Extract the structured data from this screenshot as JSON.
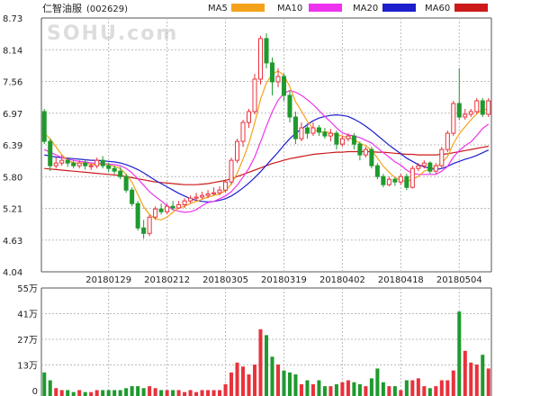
{
  "header": {
    "stock_name": "仁智油服",
    "stock_code": "(002629)",
    "watermark": "SOHU.com"
  },
  "colors": {
    "up": "#e8323c",
    "down": "#1f9a2e",
    "ma5": "#f5a21b",
    "ma10": "#ee33ee",
    "ma20": "#1e1ecc",
    "ma60": "#cc1a1a",
    "grid": "#bbbbbb",
    "frame": "#555555"
  },
  "chart_data": [
    {
      "type": "candlestick",
      "legend": [
        {
          "name": "MA5",
          "color": "#f5a21b"
        },
        {
          "name": "MA10",
          "color": "#ee33ee"
        },
        {
          "name": "MA20",
          "color": "#1e1ecc"
        },
        {
          "name": "MA60",
          "color": "#cc1a1a"
        }
      ],
      "y_ticks": [
        "8.73",
        "8.14",
        "7.56",
        "6.97",
        "6.39",
        "5.80",
        "5.21",
        "4.63",
        "4.04"
      ],
      "ylim": [
        4.04,
        8.73
      ],
      "x_ticks": [
        {
          "label": "20180129",
          "index": 11
        },
        {
          "label": "20180212",
          "index": 21
        },
        {
          "label": "20180305",
          "index": 31
        },
        {
          "label": "20180319",
          "index": 41
        },
        {
          "label": "20180402",
          "index": 51
        },
        {
          "label": "20180418",
          "index": 61
        },
        {
          "label": "20180504",
          "index": 71
        }
      ],
      "candles": [
        [
          7.0,
          6.45,
          7.05,
          6.4
        ],
        [
          6.45,
          6.0,
          6.5,
          5.9
        ],
        [
          6.0,
          6.05,
          6.15,
          5.95
        ],
        [
          6.05,
          6.1,
          6.2,
          6.0
        ],
        [
          6.1,
          6.05,
          6.15,
          5.98
        ],
        [
          6.05,
          6.0,
          6.1,
          5.95
        ],
        [
          6.0,
          6.05,
          6.1,
          5.95
        ],
        [
          6.05,
          6.0,
          6.12,
          5.93
        ],
        [
          6.0,
          6.0,
          6.05,
          5.92
        ],
        [
          6.0,
          6.1,
          6.15,
          5.95
        ],
        [
          6.1,
          6.0,
          6.18,
          5.95
        ],
        [
          6.0,
          5.95,
          6.05,
          5.88
        ],
        [
          5.95,
          5.9,
          6.0,
          5.85
        ],
        [
          5.9,
          5.8,
          5.98,
          5.75
        ],
        [
          5.8,
          5.55,
          5.85,
          5.5
        ],
        [
          5.55,
          5.3,
          5.6,
          5.25
        ],
        [
          5.3,
          4.85,
          5.35,
          4.8
        ],
        [
          4.85,
          4.75,
          5.0,
          4.65
        ],
        [
          4.75,
          5.05,
          5.1,
          4.7
        ],
        [
          5.05,
          5.2,
          5.25,
          5.0
        ],
        [
          5.2,
          5.15,
          5.3,
          5.1
        ],
        [
          5.15,
          5.25,
          5.3,
          5.1
        ],
        [
          5.25,
          5.22,
          5.35,
          5.18
        ],
        [
          5.22,
          5.28,
          5.35,
          5.2
        ],
        [
          5.28,
          5.35,
          5.4,
          5.22
        ],
        [
          5.35,
          5.4,
          5.45,
          5.3
        ],
        [
          5.4,
          5.42,
          5.5,
          5.35
        ],
        [
          5.42,
          5.45,
          5.52,
          5.38
        ],
        [
          5.45,
          5.48,
          5.55,
          5.4
        ],
        [
          5.48,
          5.5,
          5.6,
          5.45
        ],
        [
          5.5,
          5.55,
          5.62,
          5.45
        ],
        [
          5.55,
          5.7,
          5.75,
          5.5
        ],
        [
          5.7,
          6.1,
          6.15,
          5.65
        ],
        [
          6.1,
          6.45,
          6.5,
          6.05
        ],
        [
          6.45,
          6.8,
          6.85,
          6.35
        ],
        [
          6.8,
          7.0,
          7.05,
          6.7
        ],
        [
          7.0,
          7.6,
          7.7,
          6.95
        ],
        [
          7.6,
          8.35,
          8.4,
          7.5
        ],
        [
          8.35,
          7.9,
          8.45,
          7.8
        ],
        [
          7.9,
          7.55,
          8.0,
          7.3
        ],
        [
          7.55,
          7.65,
          7.8,
          7.45
        ],
        [
          7.65,
          7.3,
          7.7,
          7.2
        ],
        [
          7.3,
          6.9,
          7.4,
          6.8
        ],
        [
          6.9,
          6.5,
          7.0,
          6.4
        ],
        [
          6.5,
          6.7,
          6.8,
          6.45
        ],
        [
          6.7,
          6.6,
          6.78,
          6.5
        ],
        [
          6.6,
          6.7,
          6.8,
          6.55
        ],
        [
          6.7,
          6.62,
          6.75,
          6.55
        ],
        [
          6.62,
          6.55,
          6.7,
          6.5
        ],
        [
          6.55,
          6.6,
          6.68,
          6.45
        ],
        [
          6.6,
          6.4,
          6.65,
          6.3
        ],
        [
          6.4,
          6.5,
          6.55,
          6.35
        ],
        [
          6.5,
          6.55,
          6.6,
          6.45
        ],
        [
          6.55,
          6.4,
          6.6,
          6.3
        ],
        [
          6.4,
          6.2,
          6.45,
          6.1
        ],
        [
          6.2,
          6.3,
          6.35,
          6.15
        ],
        [
          6.3,
          6.0,
          6.35,
          5.95
        ],
        [
          6.0,
          5.8,
          6.05,
          5.75
        ],
        [
          5.8,
          5.65,
          5.85,
          5.6
        ],
        [
          5.65,
          5.75,
          5.8,
          5.62
        ],
        [
          5.75,
          5.7,
          5.78,
          5.63
        ],
        [
          5.7,
          5.8,
          5.85,
          5.65
        ],
        [
          5.8,
          5.6,
          5.85,
          5.55
        ],
        [
          5.6,
          5.95,
          6.0,
          5.58
        ],
        [
          5.95,
          6.0,
          6.05,
          5.9
        ],
        [
          6.0,
          6.05,
          6.1,
          5.95
        ],
        [
          6.05,
          5.9,
          6.08,
          5.85
        ],
        [
          5.9,
          6.0,
          6.05,
          5.85
        ],
        [
          6.0,
          6.3,
          6.35,
          5.95
        ],
        [
          6.3,
          6.6,
          6.65,
          6.25
        ],
        [
          6.6,
          7.15,
          7.2,
          6.55
        ],
        [
          7.15,
          6.9,
          7.8,
          6.85
        ],
        [
          6.9,
          6.95,
          7.05,
          6.85
        ],
        [
          6.95,
          7.0,
          7.05,
          6.9
        ],
        [
          7.0,
          7.2,
          7.25,
          6.95
        ],
        [
          7.2,
          6.95,
          7.25,
          6.9
        ],
        [
          6.95,
          7.2,
          7.25,
          6.9
        ]
      ],
      "ma5": [
        6.6,
        6.5,
        6.35,
        6.2,
        6.1,
        6.05,
        6.05,
        6.05,
        6.02,
        6.03,
        6.03,
        6.01,
        5.99,
        5.95,
        5.84,
        5.7,
        5.47,
        5.24,
        5.1,
        5.02,
        5.0,
        5.05,
        5.14,
        5.22,
        5.25,
        5.3,
        5.34,
        5.38,
        5.42,
        5.45,
        5.48,
        5.54,
        5.66,
        5.86,
        6.12,
        6.41,
        6.79,
        7.23,
        7.53,
        7.69,
        7.75,
        7.67,
        7.46,
        7.18,
        7.01,
        6.82,
        6.68,
        6.62,
        6.63,
        6.61,
        6.57,
        6.55,
        6.52,
        6.49,
        6.41,
        6.37,
        6.29,
        6.14,
        5.99,
        5.88,
        5.78,
        5.74,
        5.7,
        5.76,
        5.8,
        5.9,
        5.94,
        5.98,
        6.05,
        6.17,
        6.41,
        6.59,
        6.72,
        6.85,
        6.96,
        7.04,
        7.04
      ],
      "ma10": [
        6.3,
        6.25,
        6.2,
        6.15,
        6.12,
        6.1,
        6.08,
        6.07,
        6.05,
        6.05,
        6.04,
        6.03,
        6.02,
        6.0,
        5.95,
        5.87,
        5.76,
        5.64,
        5.52,
        5.43,
        5.35,
        5.26,
        5.19,
        5.16,
        5.14,
        5.15,
        5.19,
        5.26,
        5.32,
        5.34,
        5.39,
        5.44,
        5.52,
        5.64,
        5.79,
        5.95,
        6.16,
        6.44,
        6.73,
        7.0,
        7.21,
        7.34,
        7.39,
        7.36,
        7.3,
        7.22,
        7.13,
        7.02,
        6.91,
        6.81,
        6.7,
        6.61,
        6.57,
        6.55,
        6.52,
        6.47,
        6.42,
        6.33,
        6.24,
        6.16,
        6.07,
        6.01,
        5.92,
        5.86,
        5.84,
        5.84,
        5.84,
        5.84,
        5.9,
        5.99,
        6.16,
        6.28,
        6.37,
        6.44,
        6.56,
        6.69,
        6.77
      ],
      "ma20": [
        6.2,
        6.18,
        6.16,
        6.15,
        6.14,
        6.13,
        6.12,
        6.11,
        6.1,
        6.1,
        6.09,
        6.08,
        6.07,
        6.05,
        6.02,
        5.98,
        5.93,
        5.87,
        5.8,
        5.73,
        5.67,
        5.61,
        5.55,
        5.49,
        5.44,
        5.39,
        5.36,
        5.34,
        5.33,
        5.34,
        5.36,
        5.39,
        5.44,
        5.51,
        5.59,
        5.68,
        5.78,
        5.89,
        6.01,
        6.13,
        6.25,
        6.38,
        6.5,
        6.6,
        6.68,
        6.76,
        6.83,
        6.88,
        6.91,
        6.93,
        6.94,
        6.93,
        6.91,
        6.86,
        6.8,
        6.73,
        6.65,
        6.56,
        6.47,
        6.38,
        6.3,
        6.22,
        6.14,
        6.08,
        6.02,
        5.98,
        5.95,
        5.93,
        5.95,
        5.99,
        6.04,
        6.08,
        6.12,
        6.15,
        6.19,
        6.24,
        6.29
      ],
      "ma60": [
        5.95,
        5.94,
        5.93,
        5.92,
        5.91,
        5.9,
        5.89,
        5.88,
        5.87,
        5.86,
        5.85,
        5.84,
        5.83,
        5.82,
        5.8,
        5.78,
        5.76,
        5.74,
        5.72,
        5.7,
        5.69,
        5.68,
        5.67,
        5.66,
        5.65,
        5.65,
        5.65,
        5.66,
        5.67,
        5.69,
        5.71,
        5.73,
        5.76,
        5.8,
        5.84,
        5.88,
        5.92,
        5.96,
        6.0,
        6.04,
        6.07,
        6.1,
        6.13,
        6.15,
        6.17,
        6.19,
        6.21,
        6.22,
        6.23,
        6.24,
        6.25,
        6.25,
        6.26,
        6.26,
        6.26,
        6.26,
        6.26,
        6.25,
        6.25,
        6.24,
        6.23,
        6.22,
        6.21,
        6.21,
        6.2,
        6.2,
        6.2,
        6.2,
        6.21,
        6.22,
        6.24,
        6.26,
        6.28,
        6.3,
        6.32,
        6.34,
        6.36
      ]
    },
    {
      "type": "bar",
      "unit": "万",
      "y_ticks": [
        "55万",
        "41万",
        "27万",
        "13万",
        "0"
      ],
      "ylim": [
        0,
        55
      ],
      "volumes": [
        12,
        8,
        4,
        3,
        3,
        2,
        3,
        2,
        2,
        3,
        3,
        3,
        3,
        3,
        4,
        5,
        5,
        4,
        5,
        4,
        3,
        3,
        3,
        3,
        2,
        3,
        2,
        3,
        3,
        3,
        3,
        6,
        12,
        17,
        15,
        11,
        16,
        34,
        31,
        20,
        16,
        13,
        12,
        11,
        6,
        8,
        6,
        8,
        5,
        5,
        6,
        7,
        8,
        7,
        6,
        5,
        9,
        14,
        7,
        5,
        5,
        3,
        8,
        8,
        9,
        5,
        4,
        5,
        8,
        8,
        13,
        43,
        23,
        17,
        16,
        21,
        14
      ]
    }
  ]
}
